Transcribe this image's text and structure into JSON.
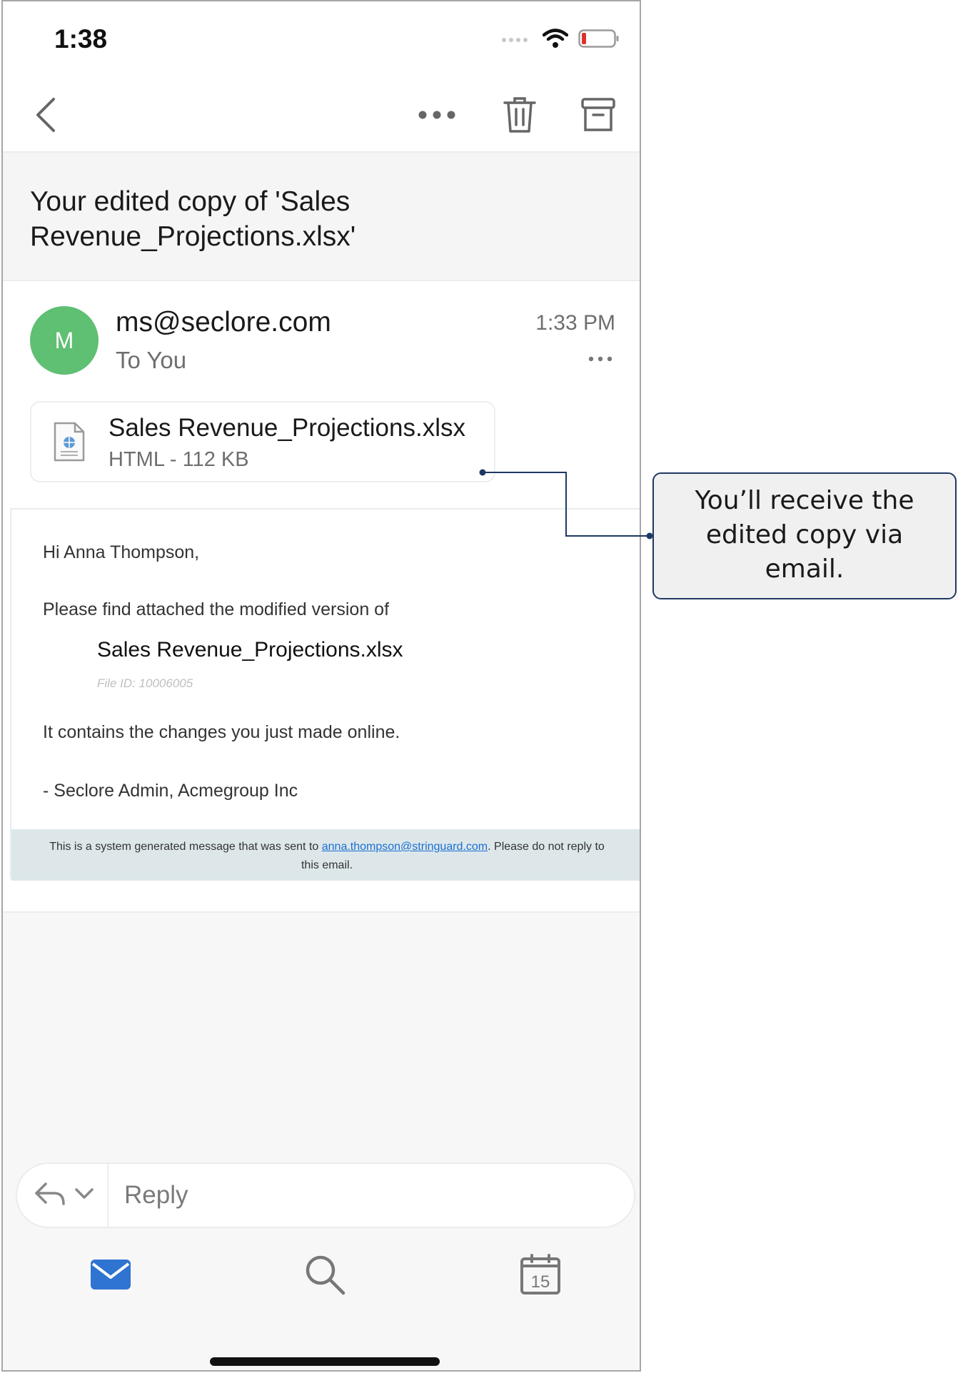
{
  "status_bar": {
    "time": "1:38",
    "icons": [
      "signal-dots-icon",
      "wifi-icon",
      "battery-low-icon"
    ]
  },
  "toolbar": {
    "icons": [
      "back-chevron-icon",
      "more-horizontal-icon",
      "trash-icon",
      "archive-icon"
    ]
  },
  "subject": "Your edited copy of 'Sales Revenue_Projections.xlsx'",
  "sender": {
    "avatar_initial": "M",
    "email": "ms@seclore.com",
    "to": "To You",
    "time": "1:33 PM"
  },
  "attachment": {
    "name": "Sales Revenue_Projections.xlsx",
    "meta": "HTML - 112 KB",
    "icon": "html-file-icon"
  },
  "email_body": {
    "greeting": "Hi Anna Thompson,",
    "intro": "Please find attached the modified version of",
    "file_name": "Sales Revenue_Projections.xlsx",
    "file_id": "File ID: 10006005",
    "changes_line": "It contains the changes you just made online.",
    "signature": "- Seclore Admin, Acmegroup Inc",
    "footer_prefix": "This is a system generated message that was sent to",
    "footer_email": "anna.thompson@stringuard.com",
    "footer_suffix": ". Please do not reply to this email."
  },
  "reply_bar": {
    "placeholder": "Reply",
    "icons": [
      "reply-arrow-icon",
      "chevron-down-icon"
    ]
  },
  "tab_bar": {
    "icons": [
      "mail-icon",
      "search-icon",
      "calendar-icon"
    ],
    "calendar_day": "15",
    "active": "mail",
    "accent_color": "#2f74d0"
  },
  "callout": {
    "text": "You’ll receive the edited copy via email."
  }
}
